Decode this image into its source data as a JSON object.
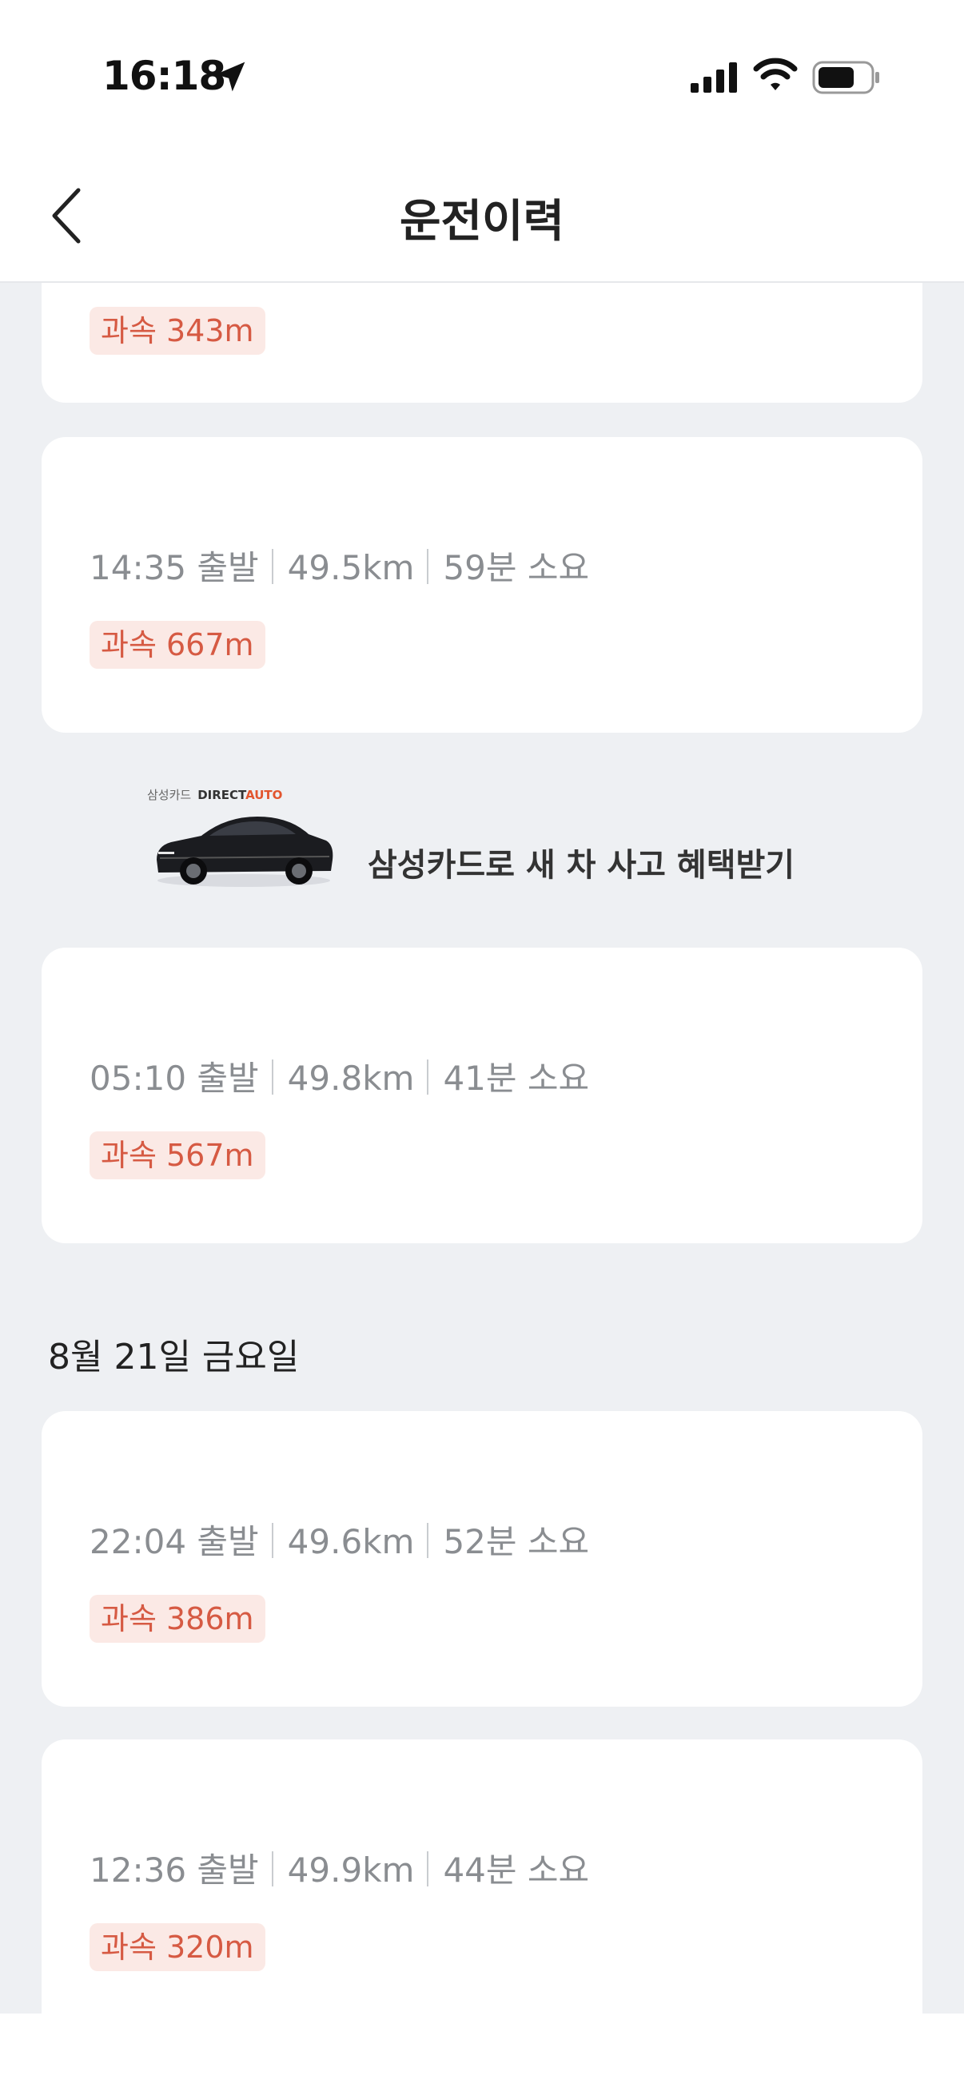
{
  "status_bar": {
    "time": "16:18",
    "icons": [
      "location-arrow-icon",
      "cellular-signal-icon",
      "wifi-icon",
      "battery-icon"
    ]
  },
  "nav": {
    "title": "운전이력",
    "back_icon": "chevron-left-icon"
  },
  "trips_top": [
    {
      "speeding": "과속 343m"
    },
    {
      "time": "14:35 출발",
      "distance": "49.5km",
      "duration": "59분 소요",
      "speeding": "과속 667m"
    }
  ],
  "banner": {
    "brand_small": "삼성카드",
    "brand_main": "DIRECT",
    "brand_accent": "AUTO",
    "text": "삼성카드로 새 차 사고 혜택받기"
  },
  "trips_mid": [
    {
      "time": "05:10 출발",
      "distance": "49.8km",
      "duration": "41분 소요",
      "speeding": "과속 567m"
    }
  ],
  "date_group": {
    "label": "8월 21일 금요일",
    "trips": [
      {
        "time": "22:04 출발",
        "distance": "49.6km",
        "duration": "52분 소요",
        "speeding": "과속 386m"
      },
      {
        "time": "12:36 출발",
        "distance": "49.9km",
        "duration": "44분 소요",
        "speeding": "과속 320m"
      }
    ]
  },
  "colors": {
    "background": "#eef0f3",
    "card": "#ffffff",
    "speeding_text": "#d65a43",
    "speeding_bg": "#fbe9e5",
    "secondary_text": "#8a8d91"
  }
}
